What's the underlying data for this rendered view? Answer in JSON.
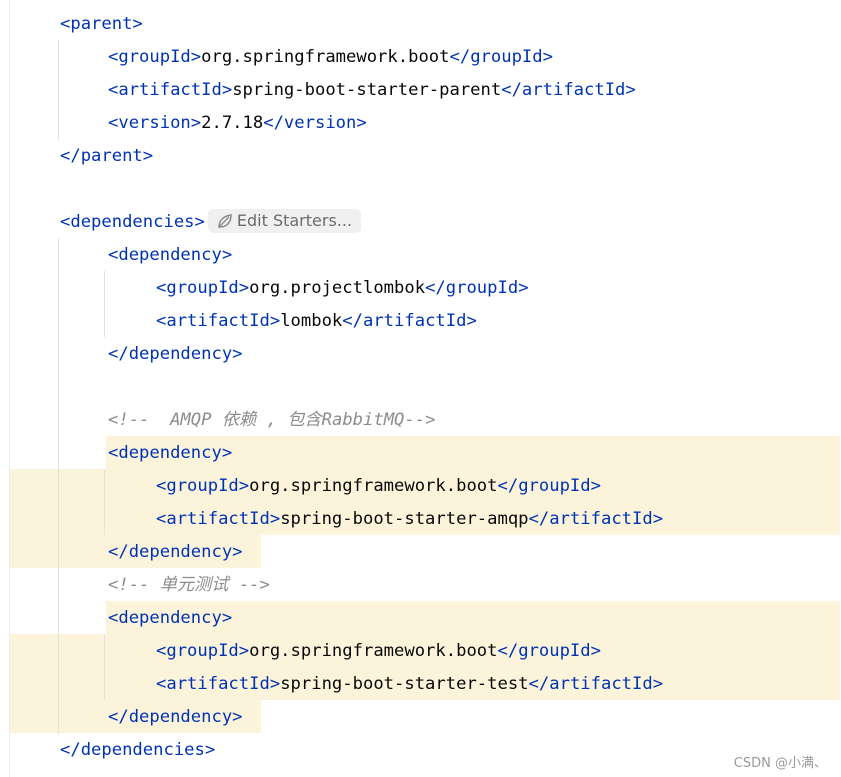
{
  "editor": {
    "lines": [
      [
        {
          "t": "tag",
          "v": "<parent>"
        }
      ],
      [
        {
          "t": "tag",
          "v": "<groupId>"
        },
        {
          "t": "txt",
          "v": "org.springframework.boot"
        },
        {
          "t": "tag",
          "v": "</groupId>"
        }
      ],
      [
        {
          "t": "tag",
          "v": "<artifactId>"
        },
        {
          "t": "txt",
          "v": "spring-boot-starter-parent"
        },
        {
          "t": "tag",
          "v": "</artifactId>"
        }
      ],
      [
        {
          "t": "tag",
          "v": "<version>"
        },
        {
          "t": "txt",
          "v": "2.7.18"
        },
        {
          "t": "tag",
          "v": "</version>"
        }
      ],
      [
        {
          "t": "tag",
          "v": "</parent>"
        }
      ],
      [],
      [
        {
          "t": "tag",
          "v": "<dependencies>"
        },
        {
          "t": "chip",
          "v": "Edit Starters..."
        }
      ],
      [
        {
          "t": "tag",
          "v": "<dependency>"
        }
      ],
      [
        {
          "t": "tag",
          "v": "<groupId>"
        },
        {
          "t": "txt",
          "v": "org.projectlombok"
        },
        {
          "t": "tag",
          "v": "</groupId>"
        }
      ],
      [
        {
          "t": "tag",
          "v": "<artifactId>"
        },
        {
          "t": "txt",
          "v": "lombok"
        },
        {
          "t": "tag",
          "v": "</artifactId>"
        }
      ],
      [
        {
          "t": "tag",
          "v": "</dependency>"
        }
      ],
      [],
      [
        {
          "t": "cmt",
          "v": "<!--  AMQP 依赖 , 包含RabbitMQ-->"
        }
      ],
      [
        {
          "t": "tag",
          "v": "<dependency>"
        }
      ],
      [
        {
          "t": "tag",
          "v": "<groupId>"
        },
        {
          "t": "txt",
          "v": "org.springframework.boot"
        },
        {
          "t": "tag",
          "v": "</groupId>"
        }
      ],
      [
        {
          "t": "tag",
          "v": "<artifactId>"
        },
        {
          "t": "txt",
          "v": "spring-boot-starter-amqp"
        },
        {
          "t": "tag",
          "v": "</artifactId>"
        }
      ],
      [
        {
          "t": "tag",
          "v": "</dependency>"
        }
      ],
      [
        {
          "t": "cmt",
          "v": "<!-- 单元测试 -->"
        }
      ],
      [
        {
          "t": "tag",
          "v": "<dependency>"
        }
      ],
      [
        {
          "t": "tag",
          "v": "<groupId>"
        },
        {
          "t": "txt",
          "v": "org.springframework.boot"
        },
        {
          "t": "tag",
          "v": "</groupId>"
        }
      ],
      [
        {
          "t": "tag",
          "v": "<artifactId>"
        },
        {
          "t": "txt",
          "v": "spring-boot-starter-test"
        },
        {
          "t": "tag",
          "v": "</artifactId>"
        }
      ],
      [
        {
          "t": "tag",
          "v": "</dependency>"
        }
      ],
      [
        {
          "t": "tag",
          "v": "</dependencies>"
        }
      ]
    ],
    "colors": {
      "tag": "#0033b3",
      "text": "#080808",
      "comment": "#8c8c8c",
      "highlight": "#fbf3da"
    }
  },
  "watermark": "CSDN @小满、"
}
